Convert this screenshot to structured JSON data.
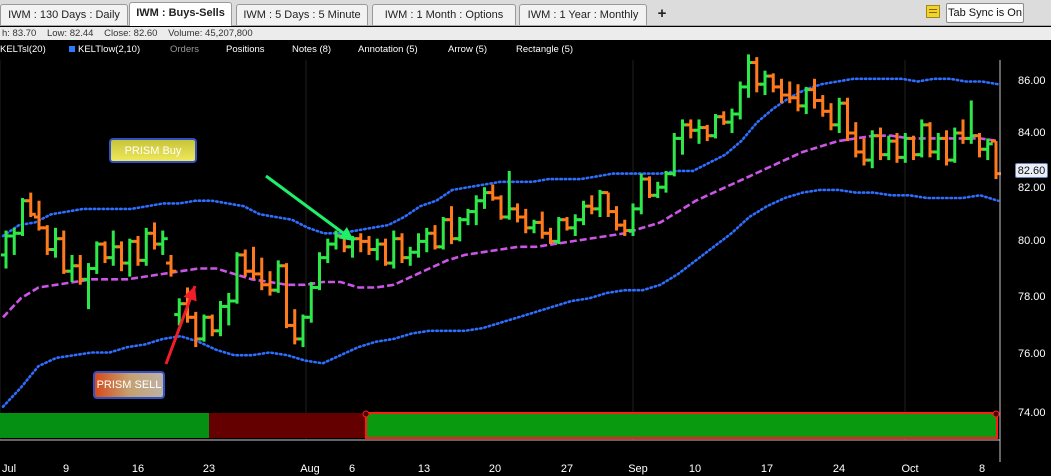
{
  "tabs": [
    {
      "label": "IWM : 130  Days : Daily",
      "active": false
    },
    {
      "label": "IWM : Buys-Sells",
      "active": true
    },
    {
      "label": "IWM : 5 Days : 5 Minute",
      "active": false
    },
    {
      "label": "IWM : 1 Month : Options",
      "active": false
    },
    {
      "label": "IWM : 1 Year : Monthly",
      "active": false
    }
  ],
  "add_tab_label": "+",
  "tab_sync_label": "Tab Sync is On",
  "ohlc": {
    "high": "h: 83.70",
    "low": "Low: 82.44",
    "close": "Close: 82.60",
    "volume": "Volume: 45,207,800"
  },
  "toolbar": {
    "kelt_hi": "KELTsl(20)",
    "kelt_low": "KELTlow(2,10)",
    "orders": "Orders",
    "positions": "Positions",
    "notes": "Notes (8)",
    "annotation": "Annotation (5)",
    "arrow": "Arrow (5)",
    "rectangle": "Rectangle (5)"
  },
  "annotations": {
    "buy_label": "PRISM Buy",
    "sell_label": "PRISM SELL"
  },
  "last_price": "82.60",
  "colors": {
    "up": "#2ee84a",
    "down": "#ff7a1c",
    "upper_band": "#2f6dff",
    "midline": "#cc55e8",
    "buy_arrow": "#1ef06a",
    "sell_arrow": "#f01d2a",
    "signal_green": "#058f13",
    "signal_red": "#650000"
  },
  "chart_data": {
    "type": "ohlc",
    "y_axis_labels": [
      "86.00",
      "84.00",
      "82.00",
      "80.00",
      "78.00",
      "76.00",
      "74.00"
    ],
    "x_axis_labels": [
      "Jul",
      "9",
      "16",
      "23",
      "Aug",
      "6",
      "13",
      "20",
      "27",
      "Sep",
      "10",
      "17",
      "24",
      "Oct",
      "8"
    ],
    "ylim": [
      73.2,
      87.4
    ],
    "bars": [
      {
        "o": 79.6,
        "h": 80.5,
        "l": 79.1,
        "c": 80.3
      },
      {
        "o": 80.3,
        "h": 80.6,
        "l": 79.6,
        "c": 80.4
      },
      {
        "o": 80.4,
        "h": 81.7,
        "l": 80.3,
        "c": 81.6
      },
      {
        "o": 81.6,
        "h": 81.9,
        "l": 81.0,
        "c": 81.1
      },
      {
        "o": 81.0,
        "h": 81.6,
        "l": 80.5,
        "c": 80.6
      },
      {
        "o": 80.6,
        "h": 80.7,
        "l": 79.6,
        "c": 79.8
      },
      {
        "o": 79.8,
        "h": 80.6,
        "l": 79.5,
        "c": 80.2
      },
      {
        "o": 80.2,
        "h": 80.5,
        "l": 78.9,
        "c": 79.0
      },
      {
        "o": 79.0,
        "h": 79.6,
        "l": 78.6,
        "c": 79.2
      },
      {
        "o": 79.2,
        "h": 79.6,
        "l": 78.5,
        "c": 78.7
      },
      {
        "o": 78.7,
        "h": 79.3,
        "l": 77.6,
        "c": 79.1
      },
      {
        "o": 79.1,
        "h": 80.1,
        "l": 78.9,
        "c": 80.0
      },
      {
        "o": 80.0,
        "h": 80.1,
        "l": 79.3,
        "c": 79.5
      },
      {
        "o": 79.5,
        "h": 80.5,
        "l": 79.2,
        "c": 79.9
      },
      {
        "o": 79.9,
        "h": 80.1,
        "l": 79.0,
        "c": 79.3
      },
      {
        "o": 79.3,
        "h": 80.2,
        "l": 78.8,
        "c": 80.1
      },
      {
        "o": 80.1,
        "h": 80.3,
        "l": 79.2,
        "c": 79.4
      },
      {
        "o": 79.4,
        "h": 80.6,
        "l": 79.2,
        "c": 80.4
      },
      {
        "o": 80.4,
        "h": 80.8,
        "l": 79.8,
        "c": 80.0
      },
      {
        "o": 80.0,
        "h": 80.5,
        "l": 79.6,
        "c": 80.2
      },
      {
        "o": 79.3,
        "h": 79.6,
        "l": 78.8,
        "c": 79.0
      },
      {
        "o": 77.4,
        "h": 78.0,
        "l": 77.0,
        "c": 77.8
      },
      {
        "o": 77.8,
        "h": 78.4,
        "l": 77.1,
        "c": 77.3
      },
      {
        "o": 77.3,
        "h": 77.5,
        "l": 76.2,
        "c": 76.5
      },
      {
        "o": 76.5,
        "h": 77.4,
        "l": 76.4,
        "c": 77.3
      },
      {
        "o": 77.3,
        "h": 77.4,
        "l": 76.6,
        "c": 76.8
      },
      {
        "o": 76.8,
        "h": 77.9,
        "l": 76.6,
        "c": 77.7
      },
      {
        "o": 77.7,
        "h": 78.2,
        "l": 77.0,
        "c": 77.9
      },
      {
        "o": 77.9,
        "h": 79.7,
        "l": 77.8,
        "c": 79.6
      },
      {
        "o": 79.6,
        "h": 79.8,
        "l": 78.8,
        "c": 79.0
      },
      {
        "o": 79.0,
        "h": 79.9,
        "l": 78.7,
        "c": 78.9
      },
      {
        "o": 78.9,
        "h": 79.5,
        "l": 78.3,
        "c": 78.5
      },
      {
        "o": 78.5,
        "h": 79.0,
        "l": 78.1,
        "c": 78.3
      },
      {
        "o": 78.3,
        "h": 79.4,
        "l": 78.2,
        "c": 79.2
      },
      {
        "o": 79.2,
        "h": 79.3,
        "l": 76.9,
        "c": 77.0
      },
      {
        "o": 77.0,
        "h": 77.6,
        "l": 76.3,
        "c": 76.5
      },
      {
        "o": 76.5,
        "h": 77.4,
        "l": 76.2,
        "c": 77.3
      },
      {
        "o": 77.3,
        "h": 78.6,
        "l": 77.1,
        "c": 78.4
      },
      {
        "o": 78.4,
        "h": 79.7,
        "l": 78.3,
        "c": 79.5
      },
      {
        "o": 79.5,
        "h": 80.2,
        "l": 79.3,
        "c": 80.0
      },
      {
        "o": 80.0,
        "h": 80.5,
        "l": 79.8,
        "c": 80.3
      },
      {
        "o": 80.3,
        "h": 80.4,
        "l": 79.7,
        "c": 79.9
      },
      {
        "o": 79.9,
        "h": 80.3,
        "l": 79.5,
        "c": 80.2
      },
      {
        "o": 80.2,
        "h": 80.4,
        "l": 79.7,
        "c": 80.1
      },
      {
        "o": 80.1,
        "h": 80.3,
        "l": 79.6,
        "c": 79.8
      },
      {
        "o": 79.8,
        "h": 80.2,
        "l": 79.4,
        "c": 80.0
      },
      {
        "o": 80.0,
        "h": 80.2,
        "l": 79.2,
        "c": 79.3
      },
      {
        "o": 79.3,
        "h": 80.5,
        "l": 79.1,
        "c": 80.2
      },
      {
        "o": 80.2,
        "h": 80.4,
        "l": 79.3,
        "c": 79.5
      },
      {
        "o": 79.5,
        "h": 79.9,
        "l": 79.2,
        "c": 79.7
      },
      {
        "o": 79.7,
        "h": 80.4,
        "l": 79.5,
        "c": 80.1
      },
      {
        "o": 80.1,
        "h": 80.6,
        "l": 79.7,
        "c": 80.4
      },
      {
        "o": 80.4,
        "h": 80.7,
        "l": 79.8,
        "c": 79.9
      },
      {
        "o": 79.9,
        "h": 81.0,
        "l": 79.8,
        "c": 80.9
      },
      {
        "o": 80.9,
        "h": 81.4,
        "l": 80.0,
        "c": 80.2
      },
      {
        "o": 80.2,
        "h": 81.0,
        "l": 80.1,
        "c": 80.9
      },
      {
        "o": 80.9,
        "h": 81.3,
        "l": 80.7,
        "c": 81.2
      },
      {
        "o": 81.2,
        "h": 81.8,
        "l": 80.7,
        "c": 81.6
      },
      {
        "o": 81.6,
        "h": 82.1,
        "l": 81.3,
        "c": 81.9
      },
      {
        "o": 81.9,
        "h": 82.2,
        "l": 81.6,
        "c": 81.7
      },
      {
        "o": 81.7,
        "h": 81.8,
        "l": 80.9,
        "c": 81.0
      },
      {
        "o": 81.0,
        "h": 82.7,
        "l": 80.9,
        "c": 81.3
      },
      {
        "o": 81.3,
        "h": 81.5,
        "l": 80.8,
        "c": 81.0
      },
      {
        "o": 81.0,
        "h": 81.3,
        "l": 80.4,
        "c": 80.6
      },
      {
        "o": 80.6,
        "h": 80.9,
        "l": 80.4,
        "c": 80.8
      },
      {
        "o": 80.8,
        "h": 81.2,
        "l": 80.2,
        "c": 80.4
      },
      {
        "o": 80.4,
        "h": 80.6,
        "l": 80.0,
        "c": 80.1
      },
      {
        "o": 80.1,
        "h": 81.0,
        "l": 80.0,
        "c": 80.9
      },
      {
        "o": 80.9,
        "h": 81.0,
        "l": 80.5,
        "c": 80.6
      },
      {
        "o": 80.6,
        "h": 81.1,
        "l": 80.3,
        "c": 80.9
      },
      {
        "o": 80.9,
        "h": 81.6,
        "l": 80.7,
        "c": 81.4
      },
      {
        "o": 81.4,
        "h": 81.8,
        "l": 81.1,
        "c": 81.3
      },
      {
        "o": 81.3,
        "h": 82.0,
        "l": 81.0,
        "c": 81.9
      },
      {
        "o": 81.9,
        "h": 81.9,
        "l": 81.0,
        "c": 81.2
      },
      {
        "o": 81.2,
        "h": 81.4,
        "l": 80.5,
        "c": 80.7
      },
      {
        "o": 80.7,
        "h": 80.9,
        "l": 80.3,
        "c": 80.5
      },
      {
        "o": 80.5,
        "h": 81.5,
        "l": 80.3,
        "c": 81.3
      },
      {
        "o": 81.3,
        "h": 82.6,
        "l": 81.1,
        "c": 82.4
      },
      {
        "o": 82.4,
        "h": 82.5,
        "l": 81.7,
        "c": 81.8
      },
      {
        "o": 81.8,
        "h": 82.3,
        "l": 81.7,
        "c": 82.1
      },
      {
        "o": 82.1,
        "h": 82.7,
        "l": 81.9,
        "c": 82.6
      },
      {
        "o": 82.6,
        "h": 84.1,
        "l": 82.5,
        "c": 83.9
      },
      {
        "o": 83.9,
        "h": 84.6,
        "l": 83.3,
        "c": 84.4
      },
      {
        "o": 84.4,
        "h": 84.6,
        "l": 83.9,
        "c": 84.2
      },
      {
        "o": 84.2,
        "h": 84.6,
        "l": 83.7,
        "c": 84.3
      },
      {
        "o": 84.3,
        "h": 84.4,
        "l": 83.8,
        "c": 84.0
      },
      {
        "o": 84.0,
        "h": 84.8,
        "l": 83.9,
        "c": 84.7
      },
      {
        "o": 84.7,
        "h": 84.9,
        "l": 84.4,
        "c": 84.5
      },
      {
        "o": 84.5,
        "h": 85.0,
        "l": 84.1,
        "c": 84.8
      },
      {
        "o": 84.8,
        "h": 86.0,
        "l": 84.6,
        "c": 85.8
      },
      {
        "o": 85.8,
        "h": 87.0,
        "l": 85.4,
        "c": 86.7
      },
      {
        "o": 86.7,
        "h": 86.9,
        "l": 85.6,
        "c": 85.9
      },
      {
        "o": 85.9,
        "h": 86.4,
        "l": 85.5,
        "c": 86.2
      },
      {
        "o": 86.2,
        "h": 86.3,
        "l": 85.6,
        "c": 85.8
      },
      {
        "o": 85.8,
        "h": 86.1,
        "l": 85.2,
        "c": 85.5
      },
      {
        "o": 85.5,
        "h": 86.0,
        "l": 85.2,
        "c": 85.4
      },
      {
        "o": 85.4,
        "h": 85.9,
        "l": 84.9,
        "c": 85.1
      },
      {
        "o": 85.1,
        "h": 85.8,
        "l": 84.8,
        "c": 85.7
      },
      {
        "o": 85.7,
        "h": 86.1,
        "l": 85.0,
        "c": 85.3
      },
      {
        "o": 85.3,
        "h": 85.5,
        "l": 84.7,
        "c": 84.9
      },
      {
        "o": 84.9,
        "h": 85.2,
        "l": 84.2,
        "c": 84.4
      },
      {
        "o": 84.4,
        "h": 85.4,
        "l": 84.1,
        "c": 85.2
      },
      {
        "o": 85.2,
        "h": 85.4,
        "l": 83.8,
        "c": 84.1
      },
      {
        "o": 84.1,
        "h": 84.5,
        "l": 83.2,
        "c": 83.4
      },
      {
        "o": 83.4,
        "h": 83.9,
        "l": 82.9,
        "c": 83.1
      },
      {
        "o": 83.1,
        "h": 84.2,
        "l": 82.8,
        "c": 84.0
      },
      {
        "o": 84.0,
        "h": 84.3,
        "l": 83.1,
        "c": 83.3
      },
      {
        "o": 83.3,
        "h": 84.0,
        "l": 83.1,
        "c": 83.8
      },
      {
        "o": 83.8,
        "h": 84.1,
        "l": 83.0,
        "c": 83.2
      },
      {
        "o": 83.2,
        "h": 84.1,
        "l": 83.0,
        "c": 83.9
      },
      {
        "o": 83.9,
        "h": 84.0,
        "l": 83.1,
        "c": 83.3
      },
      {
        "o": 83.3,
        "h": 84.6,
        "l": 83.2,
        "c": 84.4
      },
      {
        "o": 84.4,
        "h": 84.5,
        "l": 83.2,
        "c": 83.4
      },
      {
        "o": 83.4,
        "h": 84.1,
        "l": 83.1,
        "c": 83.9
      },
      {
        "o": 83.9,
        "h": 84.2,
        "l": 82.9,
        "c": 83.1
      },
      {
        "o": 83.1,
        "h": 84.3,
        "l": 83.0,
        "c": 84.1
      },
      {
        "o": 84.1,
        "h": 84.6,
        "l": 83.7,
        "c": 83.9
      },
      {
        "o": 83.9,
        "h": 85.3,
        "l": 83.7,
        "c": 84.0
      },
      {
        "o": 84.0,
        "h": 84.1,
        "l": 83.2,
        "c": 83.5
      },
      {
        "o": 83.5,
        "h": 83.9,
        "l": 83.1,
        "c": 83.7
      },
      {
        "o": 83.8,
        "h": 83.8,
        "l": 82.4,
        "c": 82.6
      }
    ],
    "upper_band": [
      80.3,
      80.7,
      80.8,
      81.1,
      81.2,
      81.3,
      81.3,
      81.3,
      81.3,
      81.4,
      81.5,
      81.5,
      81.6,
      81.6,
      81.5,
      81.4,
      81.1,
      81.0,
      80.9,
      80.6,
      80.4,
      80.4,
      80.5,
      80.6,
      80.7,
      81.0,
      81.4,
      81.6,
      82.0,
      82.1,
      82.2,
      82.3,
      82.3,
      82.3,
      82.4,
      82.4,
      82.4,
      82.5,
      82.6,
      82.6,
      82.6,
      82.6,
      82.7,
      82.7,
      83.0,
      83.3,
      83.8,
      84.5,
      85.0,
      85.4,
      85.7,
      85.9,
      86.0,
      86.1,
      86.1,
      86.1,
      86.1,
      86.0,
      86.1,
      86.1,
      86.0,
      86.0,
      85.9
    ],
    "midline": [
      77.3,
      78.0,
      78.4,
      78.5,
      78.6,
      78.7,
      78.7,
      78.7,
      78.8,
      78.9,
      79.0,
      79.1,
      79.1,
      78.9,
      78.7,
      78.6,
      78.5,
      78.5,
      78.6,
      78.6,
      78.4,
      78.4,
      78.5,
      78.8,
      79.1,
      79.4,
      79.6,
      79.7,
      79.8,
      79.9,
      79.9,
      80.0,
      80.1,
      80.2,
      80.3,
      80.4,
      80.6,
      80.8,
      81.2,
      81.6,
      81.9,
      82.2,
      82.5,
      82.8,
      83.1,
      83.4,
      83.6,
      83.8,
      83.9,
      84.0,
      84.0,
      83.9,
      83.9,
      83.9,
      83.9,
      83.9,
      83.8
    ],
    "lower_band": [
      74.0,
      74.7,
      75.5,
      75.8,
      75.9,
      76.0,
      76.0,
      76.2,
      76.3,
      76.5,
      76.6,
      76.4,
      76.1,
      75.9,
      75.9,
      76.0,
      75.9,
      75.7,
      75.6,
      75.9,
      76.2,
      76.4,
      76.5,
      76.7,
      76.8,
      76.8,
      76.8,
      76.9,
      77.1,
      77.3,
      77.5,
      77.7,
      77.9,
      78.0,
      78.2,
      78.3,
      78.3,
      78.5,
      78.9,
      79.4,
      79.9,
      80.4,
      81.0,
      81.4,
      81.7,
      81.9,
      82.0,
      82.0,
      81.9,
      81.9,
      81.8,
      81.8,
      81.7,
      81.7,
      81.7,
      81.8,
      81.6
    ]
  },
  "signal_bar": [
    {
      "state": "buy",
      "color": "#058f13"
    },
    {
      "state": "sell",
      "color": "#650000"
    },
    {
      "state": "buy",
      "color": "#0a9a10"
    }
  ]
}
